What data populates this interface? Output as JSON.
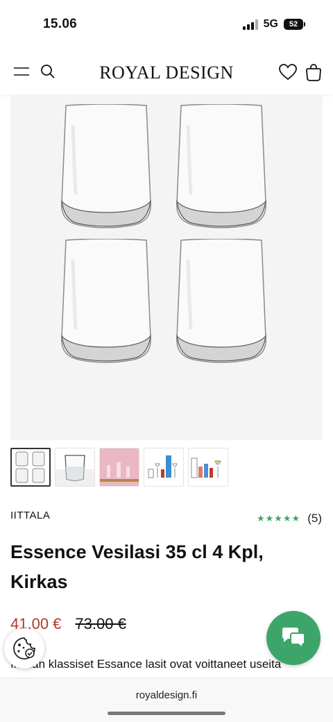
{
  "status": {
    "time": "15.06",
    "network": "5G",
    "battery": "52"
  },
  "header": {
    "logo": "ROYAL DESIGN",
    "icons": [
      "menu-icon",
      "search-icon",
      "heart-icon",
      "bag-icon"
    ]
  },
  "gallery": {
    "thumbnail_count": 5,
    "selected_index": 0
  },
  "product": {
    "brand": "IITTALA",
    "rating_stars": 5,
    "stars_text": "★★★★★",
    "review_count": "(5)",
    "title": "Essence Vesilasi 35 cl 4 Kpl, Kirkas",
    "price_sale": "41.00 €",
    "price_old": "73.00 €",
    "description_preview": "Iittalan klassiset Essance lasit ovat voittaneet useita"
  },
  "floating": {
    "cookie_icon": "cookie-icon",
    "chat_icon": "chat-icon"
  },
  "browser": {
    "url": "royaldesign.fi"
  },
  "colors": {
    "accent_green": "#3ea56a",
    "sale_red": "#b13a2a"
  }
}
